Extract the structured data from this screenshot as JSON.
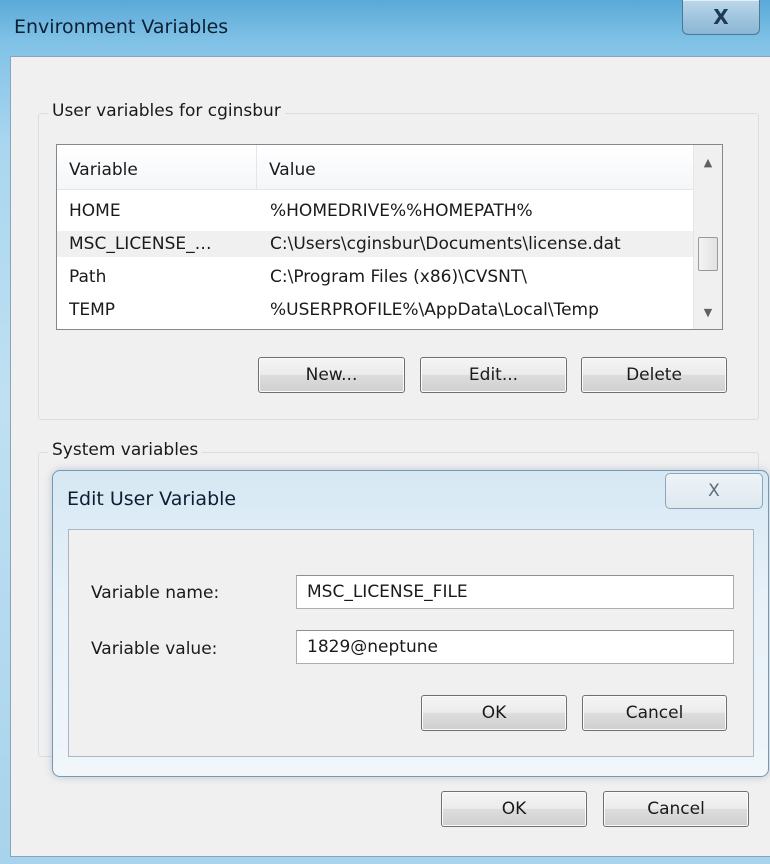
{
  "window": {
    "title": "Environment Variables",
    "close_glyph": "X"
  },
  "user_vars": {
    "group_label": "User variables for cginsbur",
    "columns": [
      "Variable",
      "Value"
    ],
    "rows": [
      {
        "name": "HOME",
        "value": "%HOMEDRIVE%%HOMEPATH%"
      },
      {
        "name": "MSC_LICENSE_…",
        "value": "C:\\Users\\cginsbur\\Documents\\license.dat"
      },
      {
        "name": "Path",
        "value": "C:\\Program Files (x86)\\CVSNT\\"
      },
      {
        "name": "TEMP",
        "value": "%USERPROFILE%\\AppData\\Local\\Temp"
      }
    ],
    "selected_row": 1,
    "scroll_up_glyph": "▲",
    "scroll_down_glyph": "▼",
    "buttons": {
      "new": "New...",
      "edit": "Edit...",
      "delete": "Delete"
    }
  },
  "system_vars": {
    "group_label": "System variables"
  },
  "edit_dialog": {
    "title": "Edit User Variable",
    "close_glyph": "X",
    "name_label": "Variable name:",
    "name_value": "MSC_LICENSE_FILE",
    "value_label": "Variable value:",
    "value_value": "1829@neptune",
    "ok": "OK",
    "cancel": "Cancel"
  },
  "footer": {
    "ok": "OK",
    "cancel": "Cancel"
  },
  "icons": {
    "window_close": "close-icon",
    "dialog_close": "close-icon",
    "scroll_up": "chevron-up-icon",
    "scroll_down": "chevron-down-icon"
  }
}
